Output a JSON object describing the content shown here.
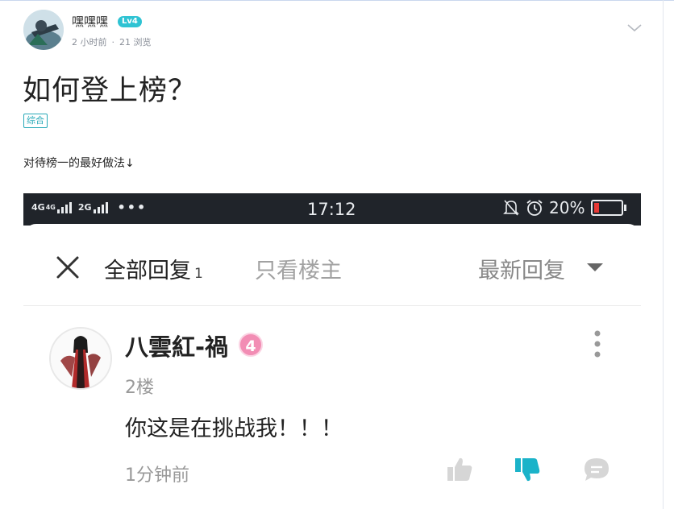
{
  "post": {
    "author": "嘿嘿嘿",
    "level": "Lv4",
    "time": "2 小时前",
    "separator": "·",
    "views": "21 浏览",
    "title": "如何登上榜？",
    "tag": "综合",
    "body": "对待榜一的最好做法↓"
  },
  "screenshot": {
    "status": {
      "net1": "4G",
      "net1b": "4G",
      "net2": "2G",
      "dots": "•••",
      "time": "17:12",
      "battery": "20%"
    },
    "tabs": {
      "all": "全部回复",
      "all_count": "1",
      "host_only": "只看楼主",
      "sort": "最新回复"
    },
    "comment": {
      "name": "八雲紅-禍",
      "badge": "4",
      "floor": "2楼",
      "text": "你这是在挑战我！！！",
      "time": "1分钟前"
    }
  },
  "colors": {
    "accent": "#2fc3d3",
    "tag": "#28a9b8",
    "dislike_active": "#1bb3c9",
    "badge": "#f28db4",
    "battery_low": "#e53935"
  }
}
